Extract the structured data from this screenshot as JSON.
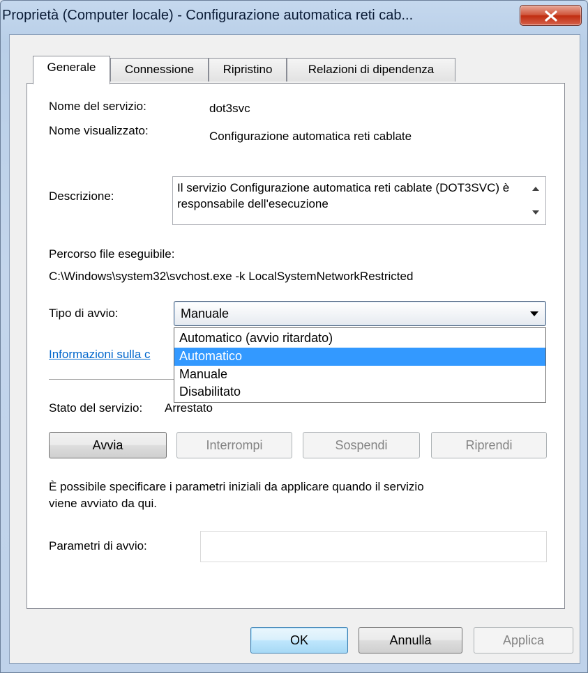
{
  "window": {
    "title": "Proprietà (Computer locale) - Configurazione automatica reti cab..."
  },
  "tabs": [
    {
      "label": "Generale"
    },
    {
      "label": "Connessione"
    },
    {
      "label": "Ripristino"
    },
    {
      "label": "Relazioni di dipendenza"
    }
  ],
  "general": {
    "service_name_label": "Nome del servizio:",
    "service_name_value": "dot3svc",
    "display_name_label": "Nome visualizzato:",
    "display_name_value": "Configurazione automatica reti cablate",
    "description_label": "Descrizione:",
    "description_value": "Il servizio Configurazione automatica reti cablate (DOT3SVC) è responsabile dell'esecuzione",
    "path_label": "Percorso file eseguibile:",
    "path_value": "C:\\Windows\\system32\\svchost.exe -k LocalSystemNetworkRestricted",
    "startup_type_label": "Tipo di avvio:",
    "startup_type_value": "Manuale",
    "startup_options": [
      "Automatico (avvio ritardato)",
      "Automatico",
      "Manuale",
      "Disabilitato"
    ],
    "help_link": "Informazioni sulla c",
    "status_label": "Stato del servizio:",
    "status_value": "Arrestato",
    "buttons": {
      "start": "Avvia",
      "stop": "Interrompi",
      "pause": "Sospendi",
      "resume": "Riprendi"
    },
    "hint_line1": "È possibile specificare i parametri iniziali da applicare quando il servizio",
    "hint_line2": "viene avviato da qui.",
    "params_label": "Parametri di avvio:",
    "params_value": ""
  },
  "footer": {
    "ok": "OK",
    "cancel": "Annulla",
    "apply": "Applica"
  }
}
